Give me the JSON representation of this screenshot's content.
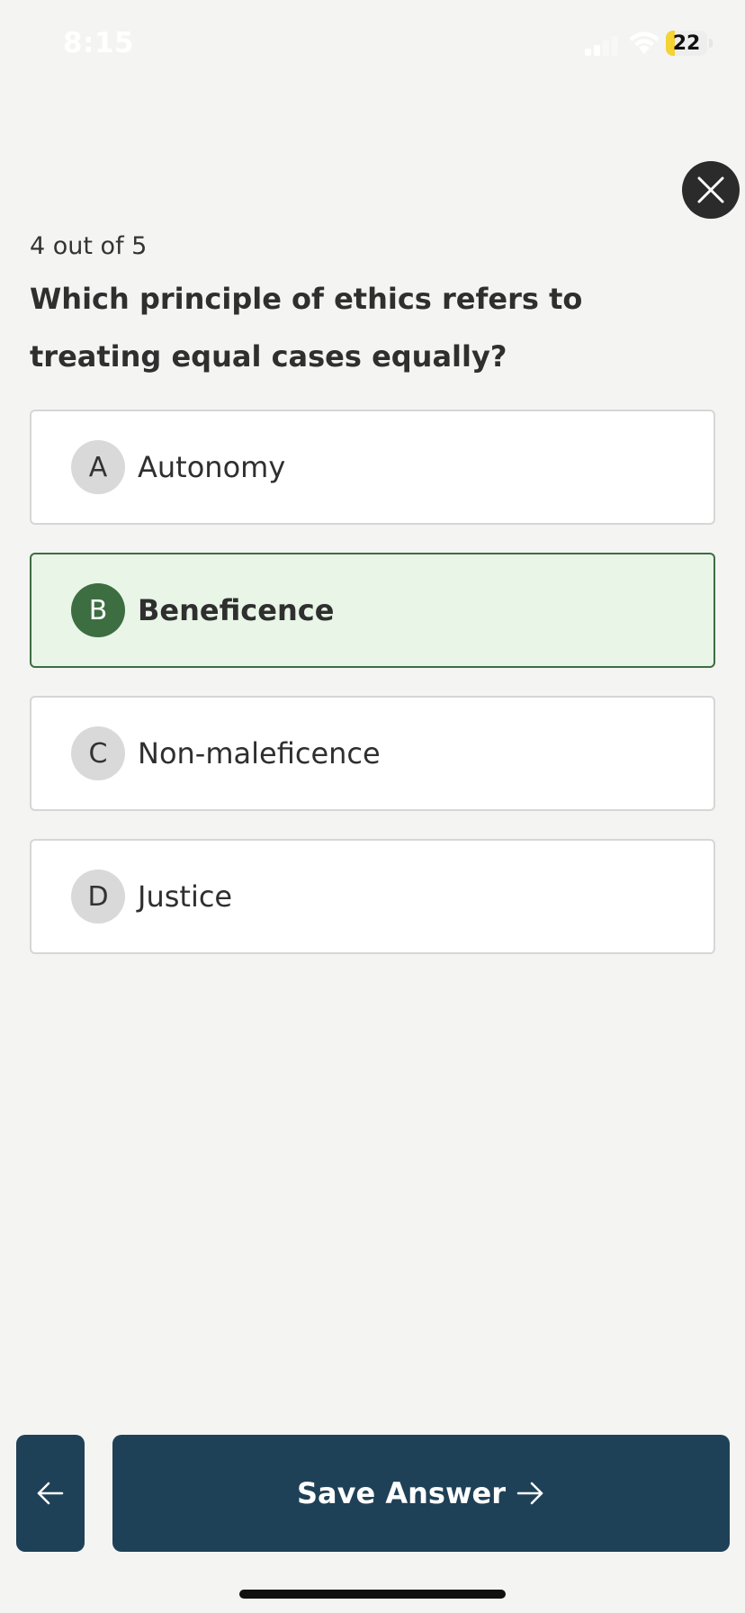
{
  "status_bar": {
    "time": "8:15",
    "battery_level": "22",
    "battery_fraction": 0.22,
    "icons": [
      "signal-icon",
      "wifi-icon",
      "battery-icon"
    ]
  },
  "quiz": {
    "progress": "4 out of 5",
    "question": "Which principle of ethics refers to treating equal cases equally?",
    "selected_option": "B",
    "options": [
      {
        "letter": "A",
        "label": "Autonomy"
      },
      {
        "letter": "B",
        "label": "Beneficence"
      },
      {
        "letter": "C",
        "label": "Non-maleficence"
      },
      {
        "letter": "D",
        "label": "Justice"
      }
    ]
  },
  "actions": {
    "save_label": "Save Answer",
    "back_icon": "arrow-left-icon",
    "close_icon": "close-icon",
    "save_icon": "arrow-right-icon"
  },
  "colors": {
    "background": "#f4f4f2",
    "primary": "#1f4157",
    "selected_green": "#3d6e41",
    "selected_bg": "#e8f5e7",
    "battery_yellow": "#f5d332"
  }
}
